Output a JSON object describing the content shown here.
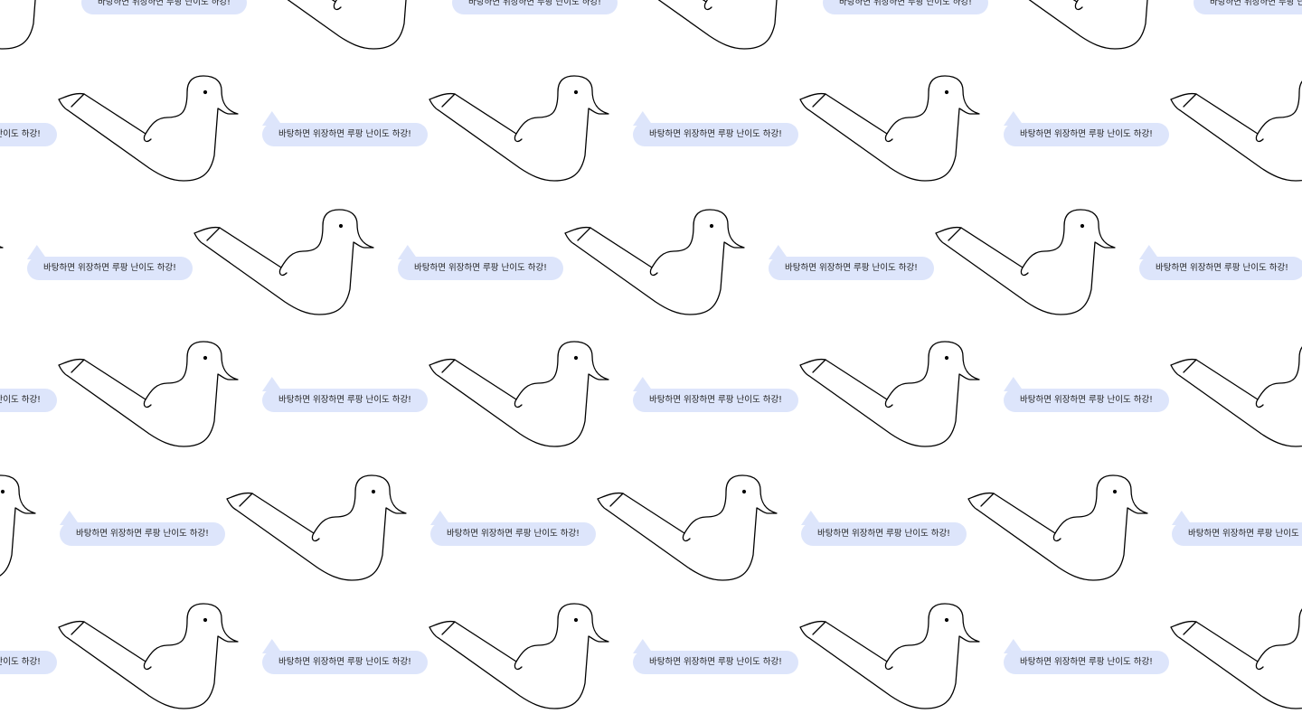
{
  "bubble_text": "바탕하면 위장하면 루팡 난이도 하강!",
  "colors": {
    "background": "#ffffff",
    "bubble": "#dde5fb",
    "stroke": "#000000"
  },
  "icons": {
    "bird": "bird-outline-icon",
    "bubble": "speech-bubble"
  }
}
